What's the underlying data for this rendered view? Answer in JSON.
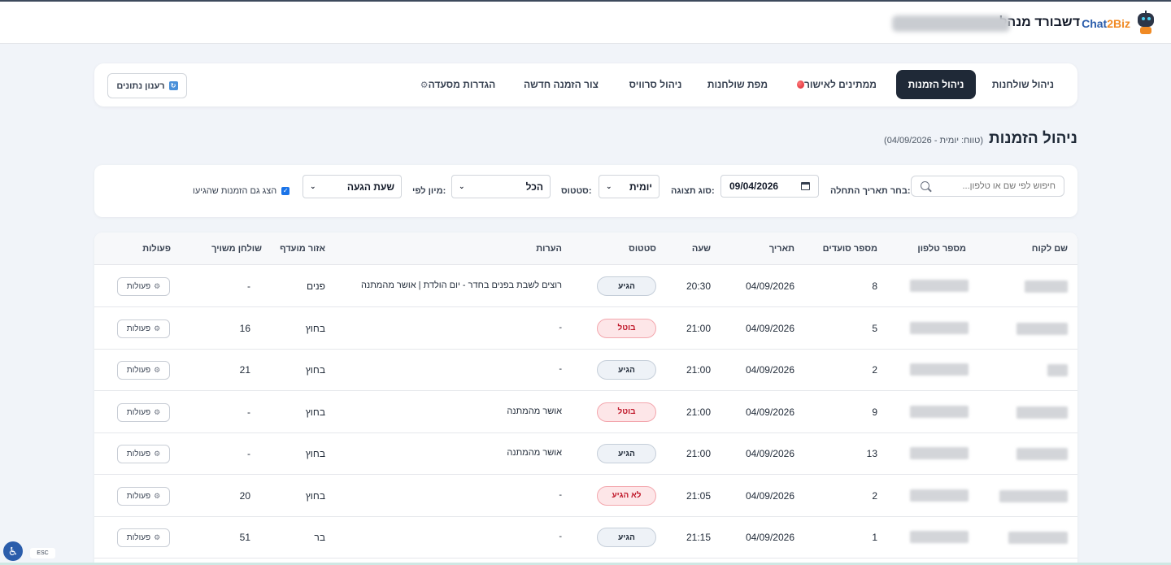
{
  "header": {
    "brand_main": "Chat",
    "brand_accent": "2Biz",
    "title": "דשבורד מנהל"
  },
  "nav": {
    "tables_mgmt": "ניהול שולחנות",
    "reservations_mgmt": "ניהול הזמנות",
    "pending_approval": "ממתינים לאישור",
    "tables_map": "מפת שולחנות",
    "service_mgmt": "ניהול סרוויס",
    "new_reservation": "צור הזמנה חדשה",
    "restaurant_settings": "הגדרות מסעדה",
    "refresh": "רענון נתונים"
  },
  "page": {
    "title": "ניהול הזמנות",
    "subtitle": "(טווח: יומית - 04/09/2026)"
  },
  "filters": {
    "search_placeholder": "חיפוש לפי שם או טלפון...",
    "start_date_label": "בחר תאריך התחלה:",
    "start_date_value": "09/04/2026",
    "view_type_label": "סוג תצוגה:",
    "view_type_value": "יומית",
    "status_label": "סטטוס:",
    "status_value": "הכל",
    "sort_label": "מיון לפי:",
    "sort_value": "שעת הגעה",
    "show_arrived_label": "הצג גם הזמנות שהגיעו",
    "show_arrived_checked": true
  },
  "table": {
    "headers": {
      "customer": "שם לקוח",
      "phone": "מספר טלפון",
      "diners": "מספר סועדים",
      "date": "תאריך",
      "time": "שעה",
      "status": "סטטוס",
      "notes": "הערות",
      "area": "אזור מועדף",
      "table": "שולחן משויך",
      "actions": "פעולות"
    },
    "action_label": "פעולות",
    "rows": [
      {
        "diners": "8",
        "date": "04/09/2026",
        "time": "20:30",
        "status": "הגיע",
        "status_type": "arrived",
        "notes": "רוצים לשבת בפנים בחדר - יום הולדת | אושר מהמתנה",
        "area": "פנים",
        "table": "-"
      },
      {
        "diners": "5",
        "date": "04/09/2026",
        "time": "21:00",
        "status": "בוטל",
        "status_type": "red",
        "notes": "-",
        "area": "בחוץ",
        "table": "16"
      },
      {
        "diners": "2",
        "date": "04/09/2026",
        "time": "21:00",
        "status": "הגיע",
        "status_type": "arrived",
        "notes": "-",
        "area": "בחוץ",
        "table": "21"
      },
      {
        "diners": "9",
        "date": "04/09/2026",
        "time": "21:00",
        "status": "בוטל",
        "status_type": "red",
        "notes": "אושר מהמתנה",
        "area": "בחוץ",
        "table": "-"
      },
      {
        "diners": "13",
        "date": "04/09/2026",
        "time": "21:00",
        "status": "הגיע",
        "status_type": "arrived",
        "notes": "אושר מהמתנה",
        "area": "בחוץ",
        "table": "-"
      },
      {
        "diners": "2",
        "date": "04/09/2026",
        "time": "21:05",
        "status": "לא הגיע",
        "status_type": "red",
        "notes": "-",
        "area": "בחוץ",
        "table": "20"
      },
      {
        "diners": "1",
        "date": "04/09/2026",
        "time": "21:15",
        "status": "הגיע",
        "status_type": "arrived",
        "notes": "-",
        "area": "בר",
        "table": "51"
      }
    ]
  },
  "footer": {
    "esc_label": "ESC"
  }
}
